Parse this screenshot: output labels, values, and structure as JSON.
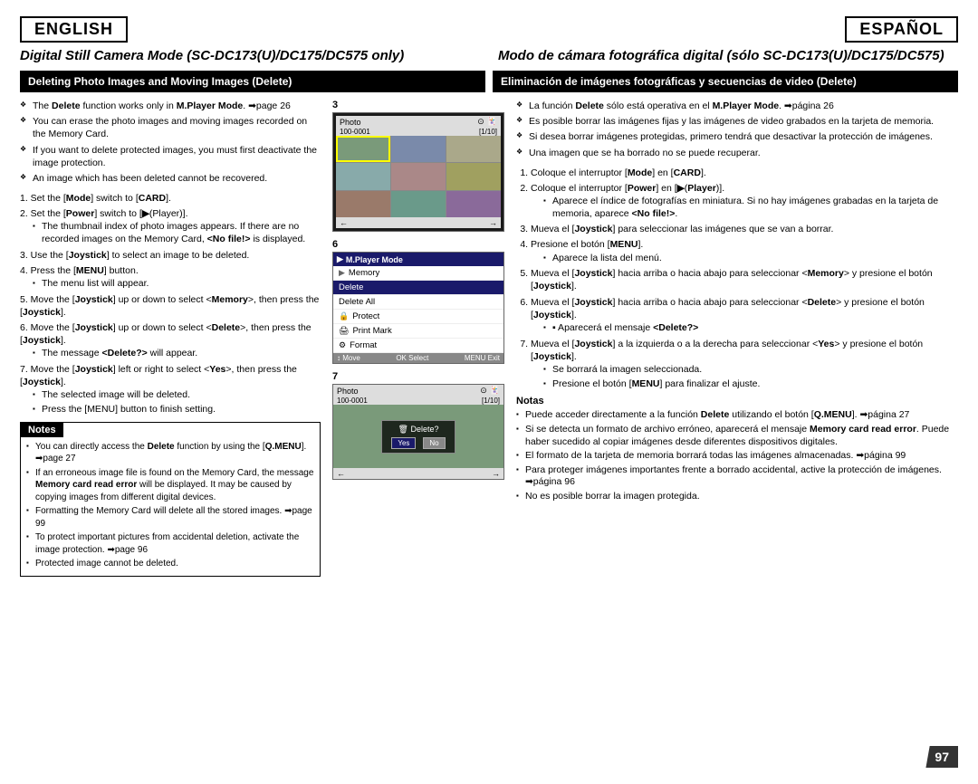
{
  "header": {
    "english": "ENGLISH",
    "spanish": "ESPAÑOL"
  },
  "titles": {
    "english": "Digital Still Camera Mode (SC-DC173(U)/DC175/DC575 only)",
    "spanish": "Modo de cámara fotográfica digital (sólo SC-DC173(U)/DC175/DC575)"
  },
  "sections": {
    "english": {
      "header": "Deleting Photo Images and Moving Images (Delete)"
    },
    "spanish": {
      "header": "Eliminación de imágenes fotográficas y secuencias de video (Delete)"
    }
  },
  "notes": {
    "english": {
      "title": "Notes"
    },
    "spanish": {
      "title": "Notas"
    }
  },
  "pageNumber": "97"
}
